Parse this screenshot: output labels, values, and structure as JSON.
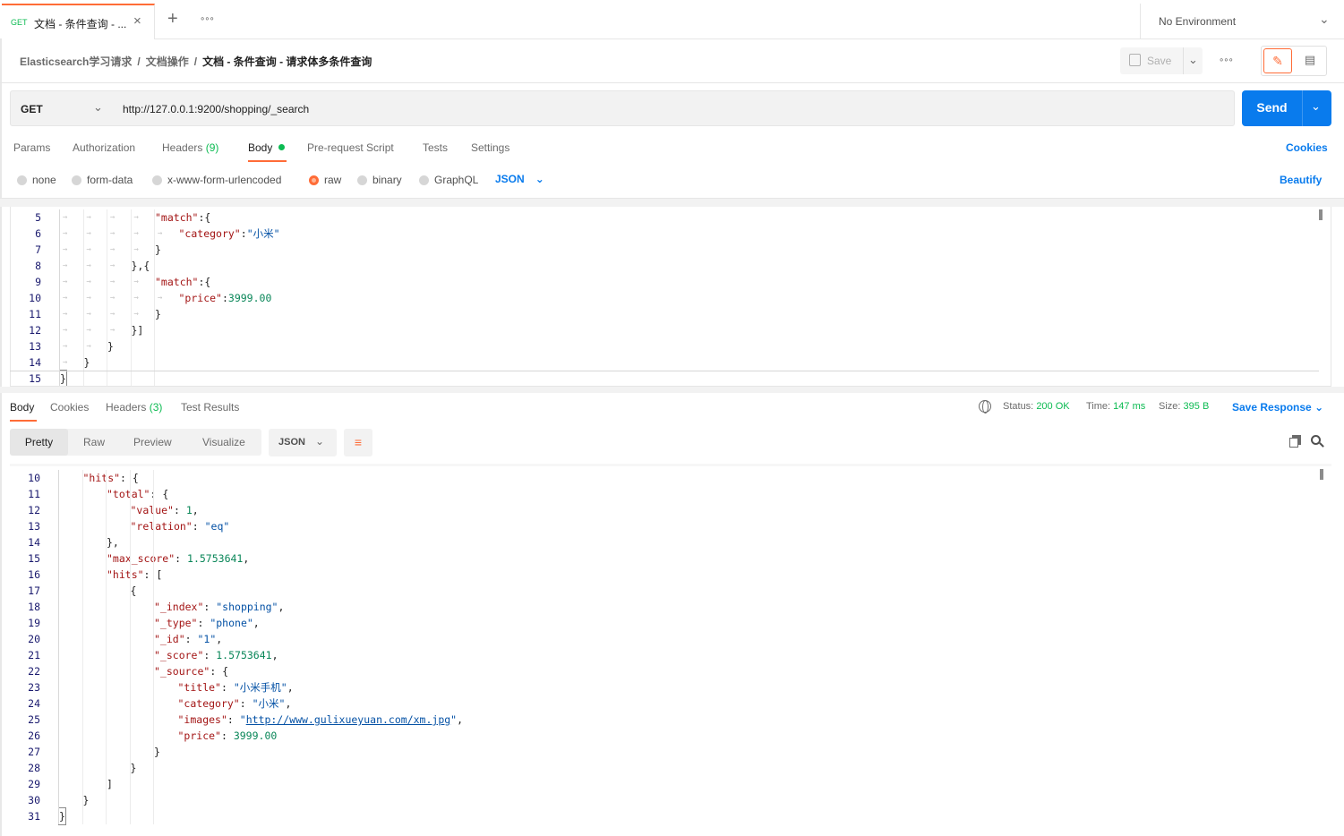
{
  "tab": {
    "method": "GET",
    "name": "文档 - 条件查询 - ...",
    "close": "×",
    "new": "+",
    "more": "∘∘∘"
  },
  "environment": {
    "label": "No Environment"
  },
  "breadcrumb": {
    "items": [
      "Elasticsearch学习请求",
      "文档操作"
    ],
    "current": "文档 - 条件查询 - 请求体多条件查询",
    "separator": "/"
  },
  "toolbar": {
    "save_label": "Save",
    "more": "∘∘∘"
  },
  "request": {
    "method": "GET",
    "url": "http://127.0.0.1:9200/shopping/_search",
    "send_label": "Send"
  },
  "request_tabs": {
    "params": "Params",
    "authorization": "Authorization",
    "headers": "Headers",
    "headers_count": "(9)",
    "body": "Body",
    "prerequest": "Pre-request Script",
    "tests": "Tests",
    "settings": "Settings",
    "cookies": "Cookies"
  },
  "body_types": {
    "none": "none",
    "form_data": "form-data",
    "urlencoded": "x-www-form-urlencoded",
    "raw": "raw",
    "binary": "binary",
    "graphql": "GraphQL",
    "format": "JSON",
    "beautify": "Beautify"
  },
  "request_body": [
    {
      "n": "5",
      "text": "\"match\":{"
    },
    {
      "n": "6",
      "text": "\"category\":\"小米\""
    },
    {
      "n": "7",
      "text": "}"
    },
    {
      "n": "8",
      "text": "},{"
    },
    {
      "n": "9",
      "text": "\"match\":{"
    },
    {
      "n": "10",
      "text": "\"price\":3999.00"
    },
    {
      "n": "11",
      "text": "}"
    },
    {
      "n": "12",
      "text": "}]"
    },
    {
      "n": "13",
      "text": "}"
    },
    {
      "n": "14",
      "text": "}"
    },
    {
      "n": "15",
      "text": "}"
    }
  ],
  "response_tabs": {
    "body": "Body",
    "cookies": "Cookies",
    "headers": "Headers",
    "headers_count": "(3)",
    "test_results": "Test Results"
  },
  "response_status": {
    "status_label": "Status:",
    "status": "200 OK",
    "time_label": "Time:",
    "time": "147 ms",
    "size_label": "Size:",
    "size": "395 B",
    "save_response": "Save Response"
  },
  "view_tabs": {
    "pretty": "Pretty",
    "raw": "Raw",
    "preview": "Preview",
    "visualize": "Visualize",
    "format": "JSON"
  },
  "response_body": [
    {
      "n": "10",
      "text": "\"hits\": {"
    },
    {
      "n": "11",
      "text": "\"total\": {"
    },
    {
      "n": "12",
      "text": "\"value\": 1,"
    },
    {
      "n": "13",
      "text": "\"relation\": \"eq\""
    },
    {
      "n": "14",
      "text": "},"
    },
    {
      "n": "15",
      "text": "\"max_score\": 1.5753641,"
    },
    {
      "n": "16",
      "text": "\"hits\": ["
    },
    {
      "n": "17",
      "text": "{"
    },
    {
      "n": "18",
      "text": "\"_index\": \"shopping\","
    },
    {
      "n": "19",
      "text": "\"_type\": \"phone\","
    },
    {
      "n": "20",
      "text": "\"_id\": \"1\","
    },
    {
      "n": "21",
      "text": "\"_score\": 1.5753641,"
    },
    {
      "n": "22",
      "text": "\"_source\": {"
    },
    {
      "n": "23",
      "text": "\"title\": \"小米手机\","
    },
    {
      "n": "24",
      "text": "\"category\": \"小米\","
    },
    {
      "n": "25",
      "text": "\"images\": \"http://www.gulixueyuan.com/xm.jpg\","
    },
    {
      "n": "26",
      "text": "\"price\": 3999.00"
    },
    {
      "n": "27",
      "text": "}"
    },
    {
      "n": "28",
      "text": "}"
    },
    {
      "n": "29",
      "text": "]"
    },
    {
      "n": "30",
      "text": "}"
    },
    {
      "n": "31",
      "text": "}"
    }
  ],
  "colors": {
    "accent": "#ff6c37",
    "primary": "#097bed",
    "success": "#0cbb52"
  }
}
